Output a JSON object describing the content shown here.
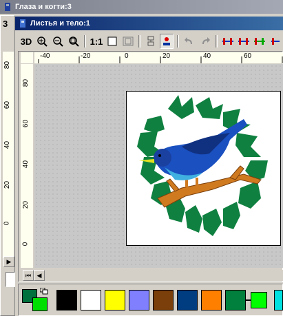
{
  "outer_window": {
    "title": "Глаза и когти:3",
    "side_tab": "3"
  },
  "inner_window": {
    "title": "Листья и тело:1"
  },
  "toolbar": {
    "btn_3d": "3D",
    "btn_zoom_in": "zoom-in-icon",
    "btn_zoom_out": "zoom-out-icon",
    "btn_zoom_fit": "zoom-fit-icon",
    "btn_actual_size": "1:1",
    "btn_page": "page-icon",
    "btn_grid": "grid-icon",
    "btn_sequence": "sequence-icon",
    "btn_stitch": "stitch-icon",
    "btn_undo": "undo-icon",
    "btn_redo": "redo-icon"
  },
  "ruler_h_labels": [
    "-40",
    "-20",
    "0",
    "20",
    "40",
    "60"
  ],
  "ruler_v_labels": [
    "80",
    "60",
    "40",
    "20",
    "0"
  ],
  "ruler_v_labels_outer": [
    "80",
    "60",
    "40",
    "20",
    "0"
  ],
  "palette": {
    "current_colors": [
      "#00703c",
      "#00e000"
    ],
    "swatches": [
      "#000000",
      "#ffffff",
      "#ffff00",
      "#8080ff",
      "#7a3f0a",
      "#003c80",
      "#ff8000",
      "#00803c",
      "#00ff00",
      "#00e0e0"
    ]
  }
}
